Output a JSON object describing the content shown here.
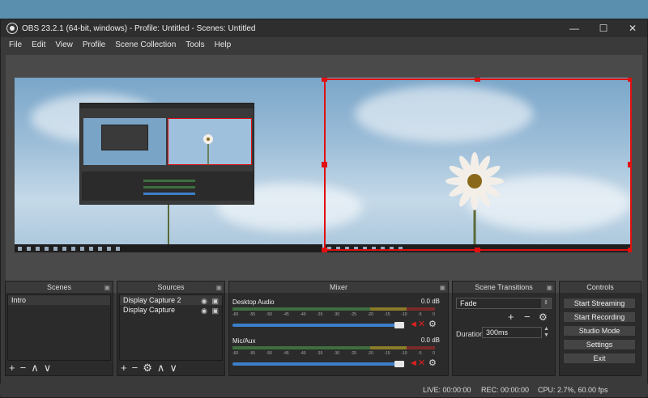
{
  "window": {
    "title": "OBS 23.2.1 (64-bit, windows) - Profile: Untitled - Scenes: Untitled",
    "controls": {
      "minimize": "—",
      "maximize": "☐",
      "close": "✕"
    }
  },
  "menu": [
    "File",
    "Edit",
    "View",
    "Profile",
    "Scene Collection",
    "Tools",
    "Help"
  ],
  "scenes": {
    "header": "Scenes",
    "items": [
      "Intro"
    ]
  },
  "sources": {
    "header": "Sources",
    "items": [
      "Display Capture 2",
      "Display Capture"
    ]
  },
  "mixer": {
    "header": "Mixer",
    "channels": [
      {
        "name": "Desktop Audio",
        "db": "0.0 dB",
        "volume": 1.0
      },
      {
        "name": "Mic/Aux",
        "db": "0.0 dB",
        "volume": 1.0
      }
    ],
    "ticks": [
      "-60",
      "-55",
      "-50",
      "-45",
      "-40",
      "-35",
      "-30",
      "-25",
      "-20",
      "-15",
      "-10",
      "-5",
      "0"
    ]
  },
  "transitions": {
    "header": "Scene Transitions",
    "selected": "Fade",
    "duration_label": "Duration",
    "duration_value": "300ms"
  },
  "controls": {
    "header": "Controls",
    "buttons": [
      "Start Streaming",
      "Start Recording",
      "Studio Mode",
      "Settings",
      "Exit"
    ]
  },
  "status": {
    "live": "LIVE: 00:00:00",
    "rec": "REC: 00:00:00",
    "cpu": "CPU: 2.7%, 60.00 fps"
  },
  "icons": {
    "add": "+",
    "remove": "−",
    "up": "∧",
    "down": "∨",
    "gear": "⚙",
    "eye": "◉",
    "lock": "▣",
    "mute": "◄✕"
  },
  "colors": {
    "selection": "#e01010",
    "slider": "#3c7fc9"
  }
}
